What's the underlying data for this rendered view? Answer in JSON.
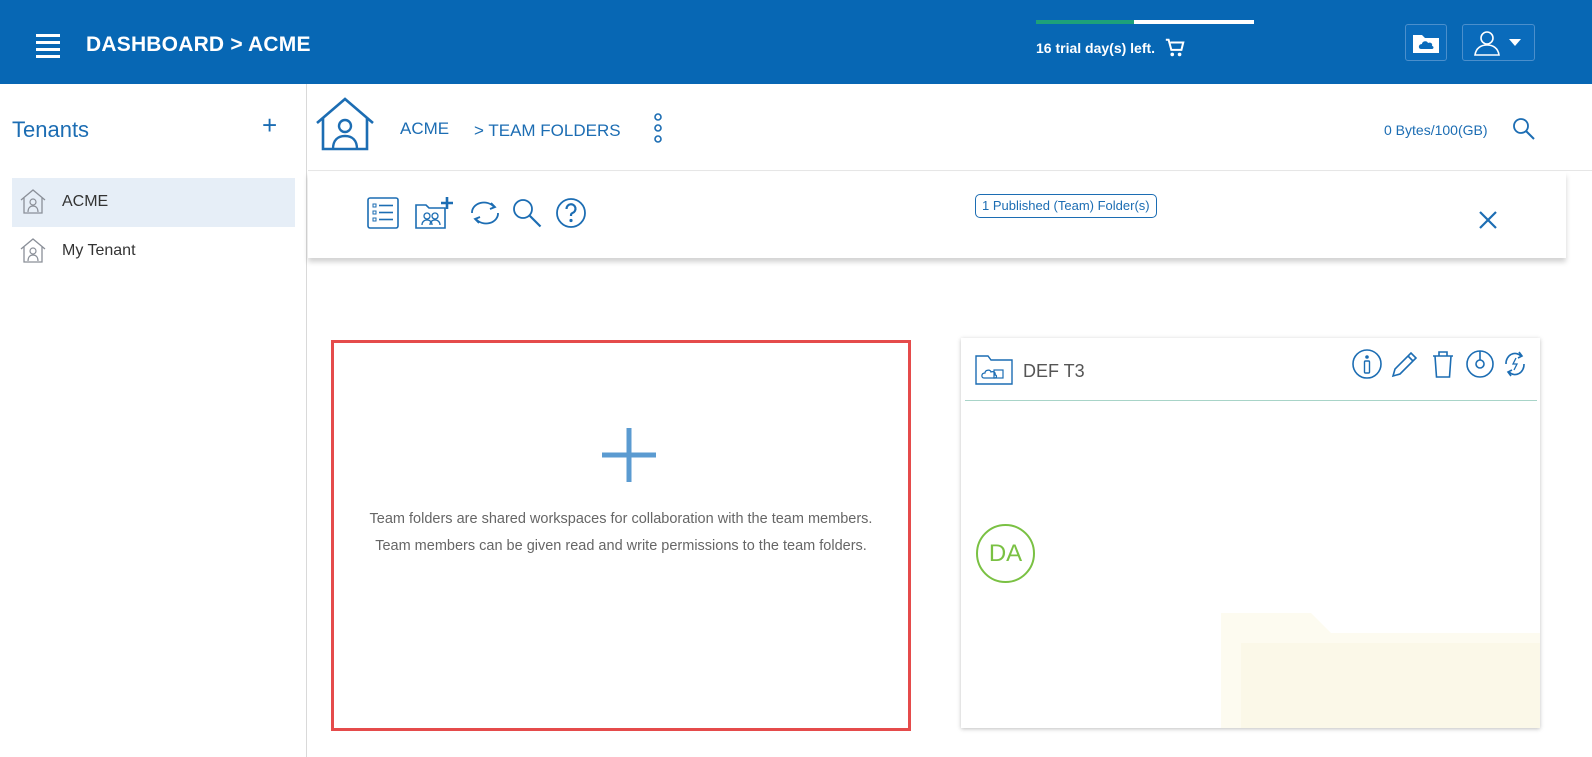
{
  "header": {
    "title": "DASHBOARD > ACME",
    "trial_text": "16 trial day(s) left.",
    "trial_progress_fraction": 0.45
  },
  "sidebar": {
    "title": "Tenants",
    "add_label": "+",
    "items": [
      {
        "label": "ACME",
        "active": true
      },
      {
        "label": "My Tenant",
        "active": false
      }
    ]
  },
  "main_header": {
    "breadcrumb_root": "ACME",
    "breadcrumb_current": "> TEAM FOLDERS",
    "quota": "0 Bytes/100(GB)"
  },
  "toolbar": {
    "published_badge": "1 Published (Team) Folder(s)"
  },
  "add_card": {
    "description_line1": "Team folders are shared workspaces for collaboration with the team members.",
    "description_line2": "Team members can be given read and write permissions to the team folders."
  },
  "folder_card": {
    "name": "DEF T3",
    "avatar_initials": "DA"
  },
  "colors": {
    "brand_blue": "#0767b4",
    "link_blue": "#1c6db3",
    "trial_green": "#1da17a",
    "avatar_green": "#7ac143",
    "highlight_red": "#e54b4b"
  }
}
